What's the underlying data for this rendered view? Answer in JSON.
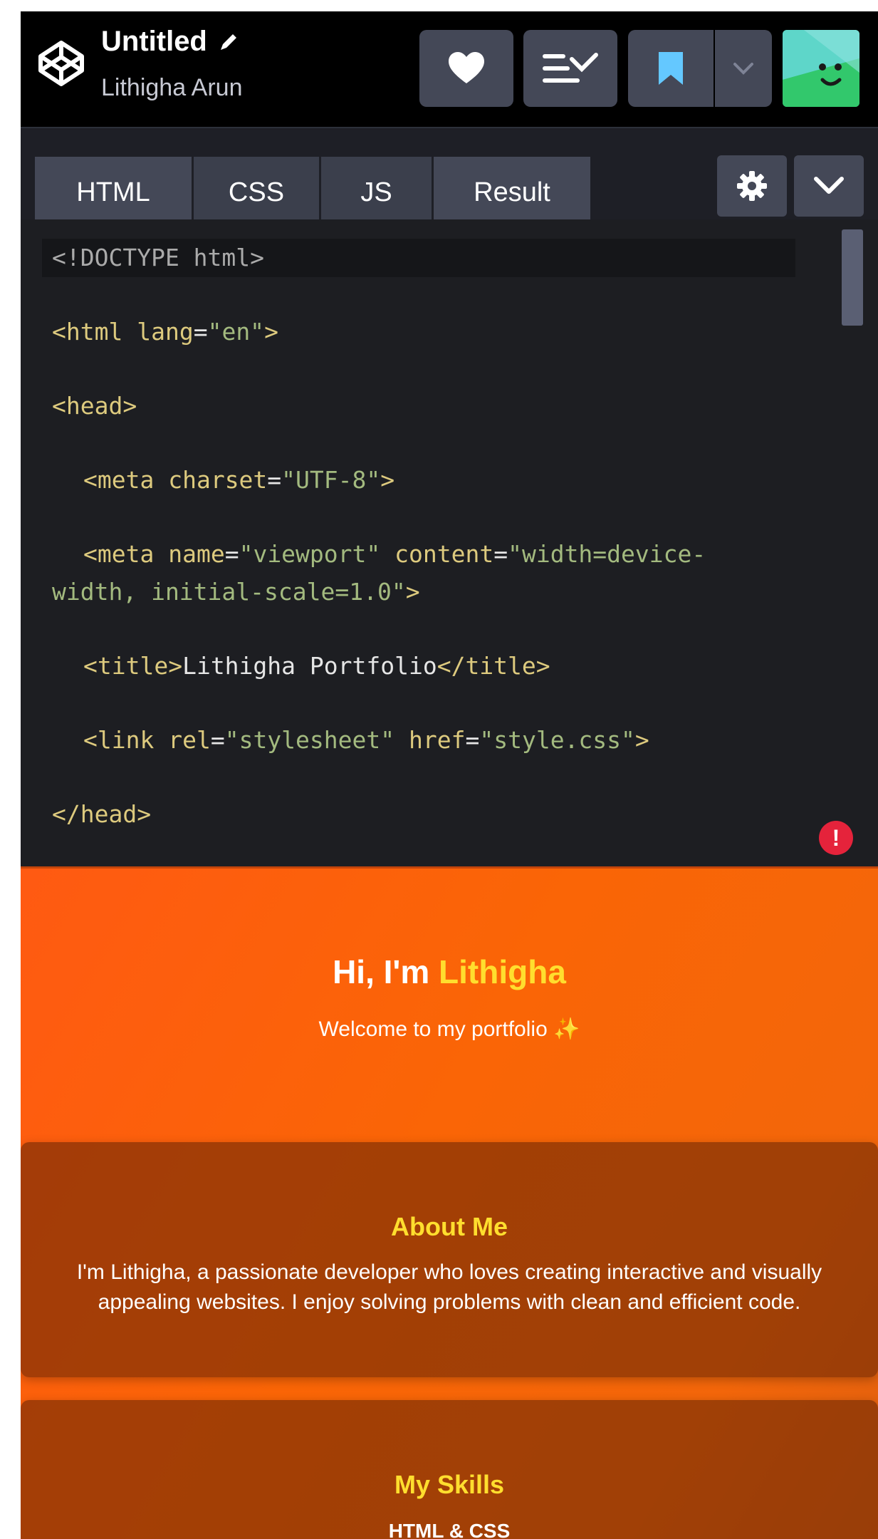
{
  "header": {
    "title": "Untitled",
    "author": "Lithigha Arun"
  },
  "tabs": [
    {
      "label": "HTML"
    },
    {
      "label": "CSS"
    },
    {
      "label": "JS"
    },
    {
      "label": "Result"
    }
  ],
  "editor": {
    "lines": {
      "doctype": "<!DOCTYPE html>",
      "html_open_tag": "<html",
      "html_lang_attr": "lang",
      "html_lang_eq": "=",
      "html_lang_val": "\"en\"",
      "html_close_bracket": ">",
      "head_open": "<head>",
      "meta1_tag": "<meta",
      "meta1_attr": "charset",
      "meta1_eq": "=",
      "meta1_val": "\"UTF-8\"",
      "meta1_end": ">",
      "meta2_tag": "<meta",
      "meta2_attr1": "name",
      "meta2_eq1": "=",
      "meta2_val1": "\"viewport\"",
      "meta2_attr2": "content",
      "meta2_eq2": "=",
      "meta2_val2a": "\"width=device-",
      "meta2_val2b": "width, initial-scale=1.0\"",
      "meta2_end": ">",
      "title_open": "<title>",
      "title_text": "Lithigha Portfolio",
      "title_close": "</title>",
      "link_tag": "<link",
      "link_attr1": "rel",
      "link_eq1": "=",
      "link_val1": "\"stylesheet\"",
      "link_attr2": "href",
      "link_eq2": "=",
      "link_val2": "\"style.css\"",
      "link_end": ">",
      "head_close": "</head>"
    },
    "error_glyph": "!"
  },
  "result": {
    "hero_greeting": "Hi, I'm ",
    "hero_name": "Lithigha",
    "hero_subtitle": "Welcome to my portfolio ",
    "hero_sparkle": "✨",
    "about_title": "About Me",
    "about_text": "I'm Lithigha, a passionate developer who loves creating interactive and visually appealing websites. I enjoy solving problems with clean and efficient code.",
    "skills_title": "My Skills",
    "skills_first": "HTML & CSS"
  },
  "colors": {
    "accent_yellow": "#ffde2e",
    "preview_orange": "#fa6506",
    "error_red": "#e5233b",
    "bookmark_blue": "#64c8ff"
  }
}
